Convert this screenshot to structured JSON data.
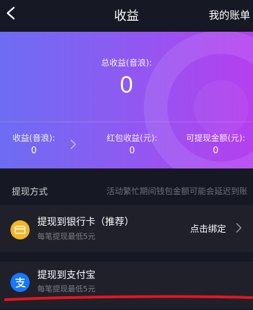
{
  "nav": {
    "title": "收益",
    "right_link": "我的账单",
    "back_icon": "chevron-left-icon"
  },
  "earnings": {
    "total_label": "总收益(音浪):",
    "total_value": "0",
    "stats": [
      {
        "label": "收益(音浪):",
        "value": "0"
      },
      {
        "label": "红包收益(元):",
        "value": "0"
      },
      {
        "label": "可提现金额(元):",
        "value": "0"
      }
    ]
  },
  "withdraw": {
    "section_title": "提现方式",
    "notice": "活动繁忙期间钱包金额可能会延迟到账",
    "methods": [
      {
        "title": "提现到银行卡（推荐）",
        "subtitle": "每笔提现最低5元",
        "action": "点击绑定",
        "icon": "bank-card-icon"
      },
      {
        "title": "提现到支付宝",
        "subtitle": "每笔提现最低5元",
        "icon": "alipay-icon"
      }
    ]
  },
  "colors": {
    "background": "#161823",
    "row_background": "#1f2029",
    "card_gradient_start": "#6d6df3",
    "card_gradient_end": "#b53ff0",
    "bank_icon": "#f5b623",
    "alipay_icon": "#1677ff",
    "annotation_red": "#e4161d"
  }
}
